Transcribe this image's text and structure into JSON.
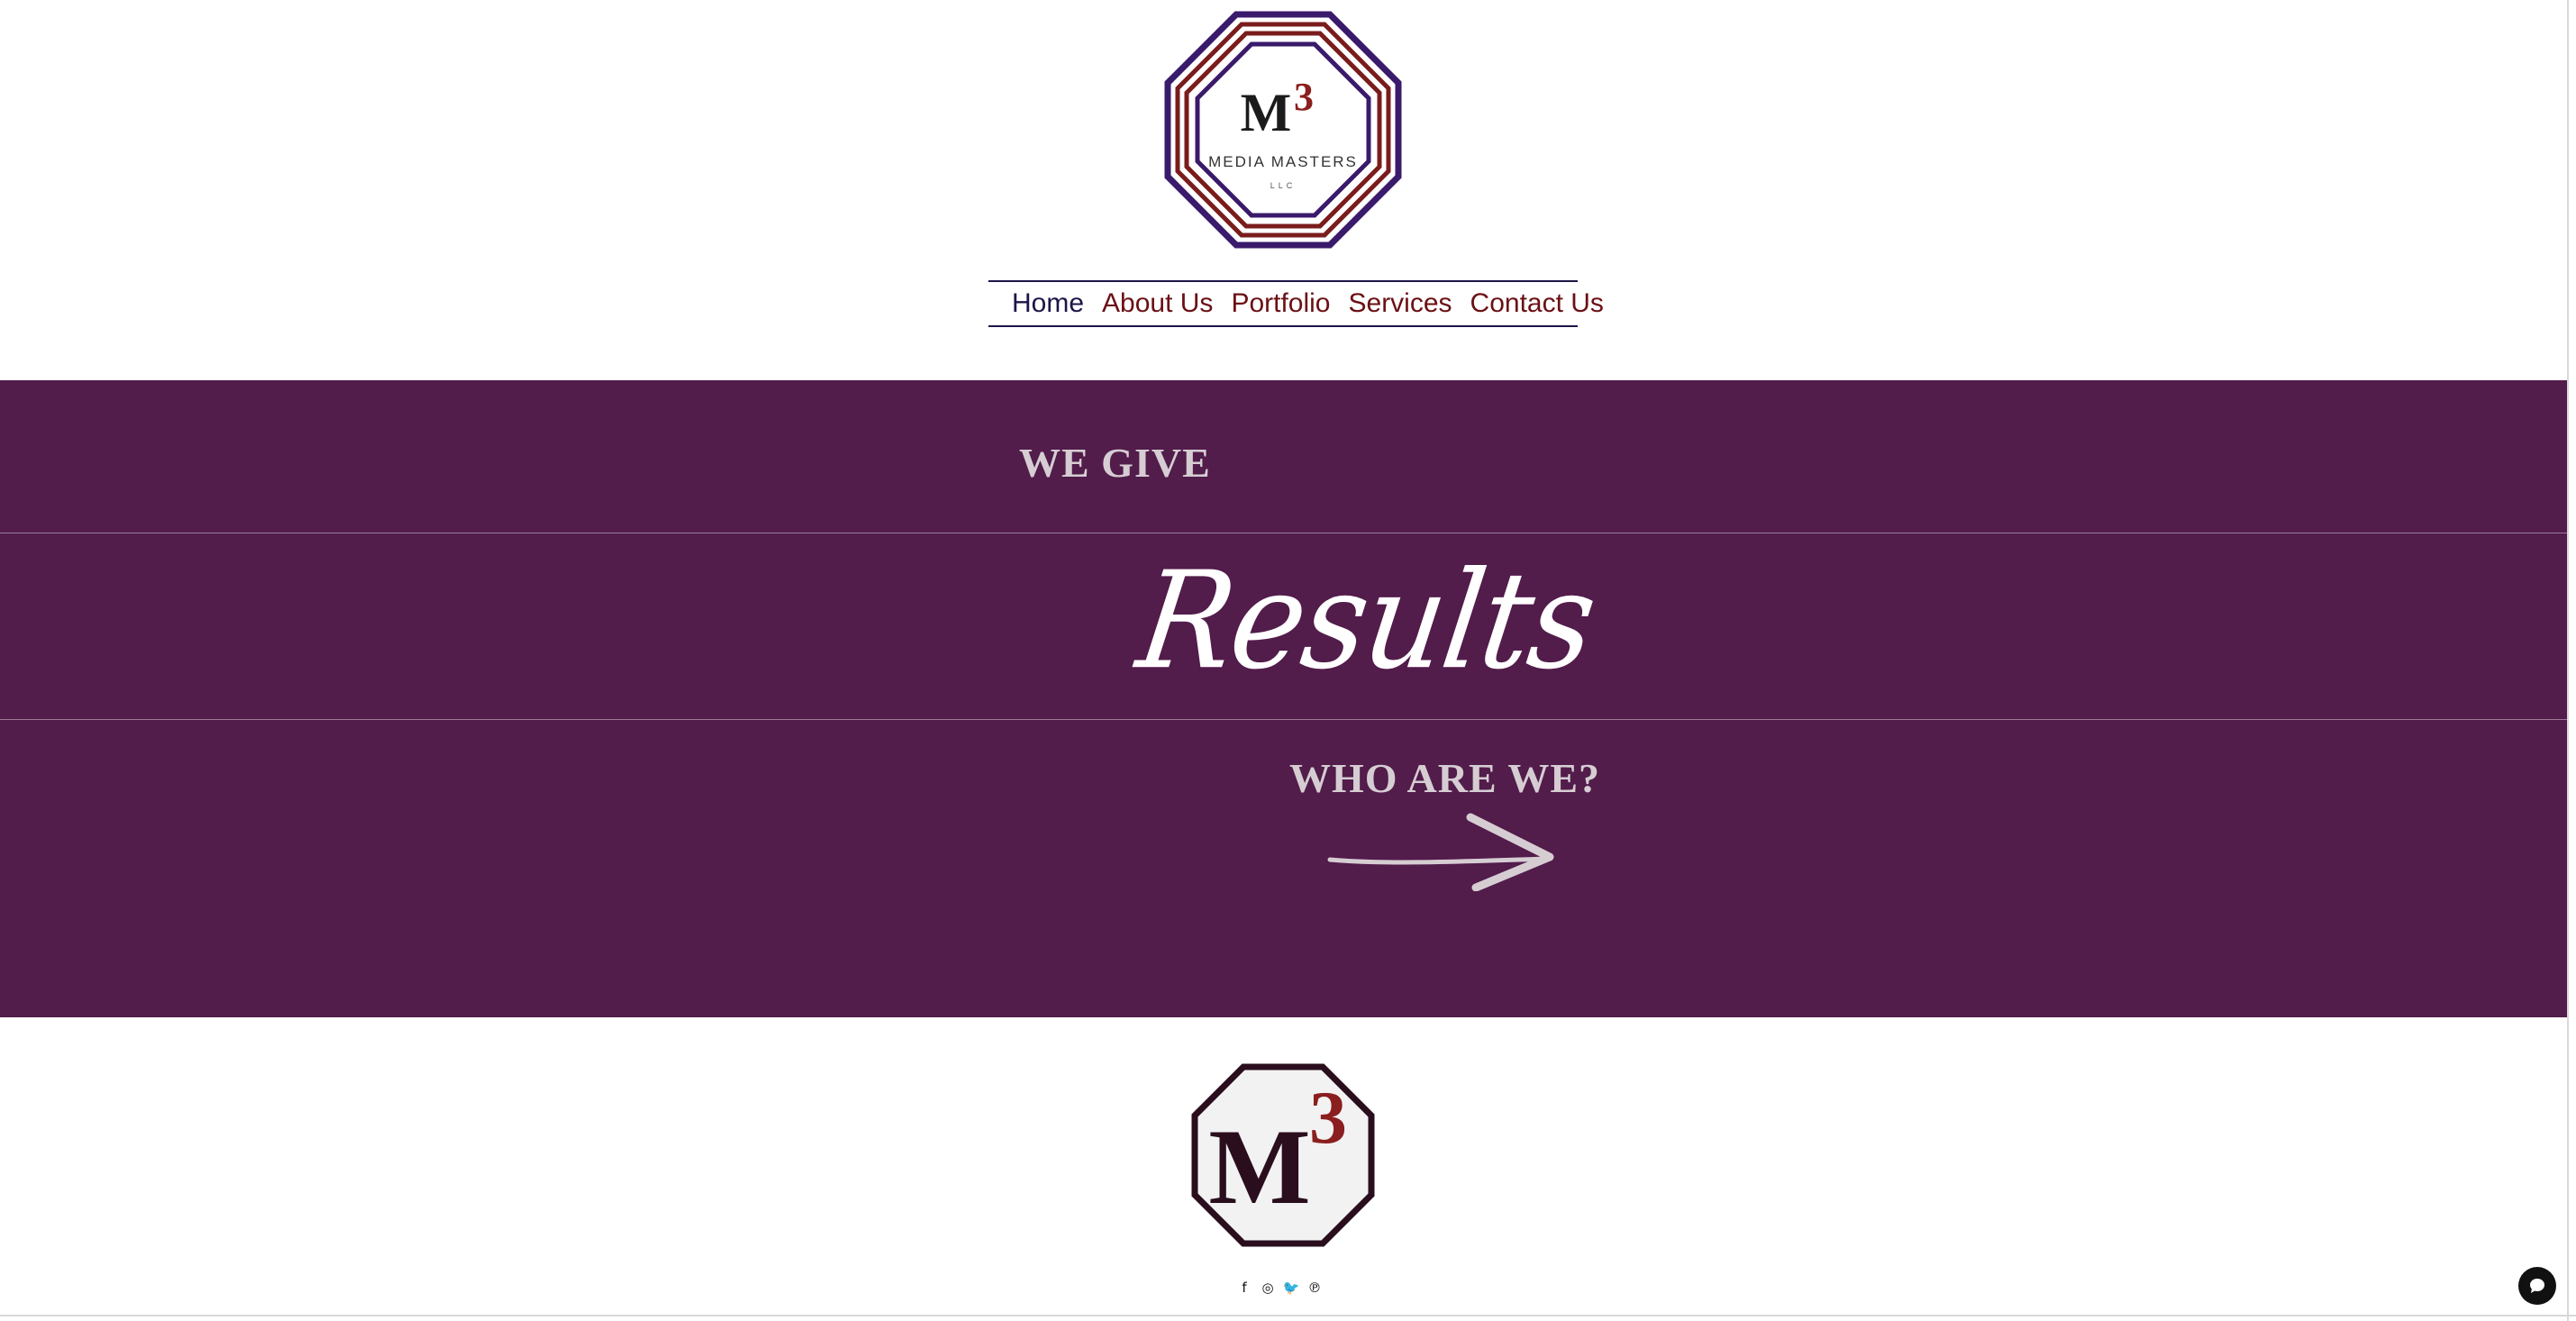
{
  "brand": {
    "logo_monogram": "M",
    "logo_superscript": "3",
    "logo_name": "MEDIA MASTERS",
    "logo_suffix": "LLC",
    "colors": {
      "purple": "#521c4b",
      "navy": "#1f1448",
      "maroon": "#6b1014"
    }
  },
  "nav": {
    "items": [
      {
        "label": "Home",
        "active": true
      },
      {
        "label": "About Us",
        "active": false
      },
      {
        "label": "Portfolio",
        "active": false
      },
      {
        "label": "Services",
        "active": false
      },
      {
        "label": "Contact Us",
        "active": false
      }
    ]
  },
  "hero": {
    "tagline_top": "WE GIVE",
    "headline": "Results",
    "cta": "WHO ARE WE?",
    "cta_icon": "arrow-right-icon"
  },
  "footer": {
    "logo_monogram": "M",
    "logo_superscript": "3",
    "social": [
      {
        "icon": "facebook-icon",
        "glyph": "f"
      },
      {
        "icon": "instagram-icon",
        "glyph": "◎"
      },
      {
        "icon": "twitter-icon",
        "glyph": "🐦"
      },
      {
        "icon": "pinterest-icon",
        "glyph": "℗"
      }
    ]
  },
  "chat": {
    "icon": "chat-bubble-icon"
  }
}
